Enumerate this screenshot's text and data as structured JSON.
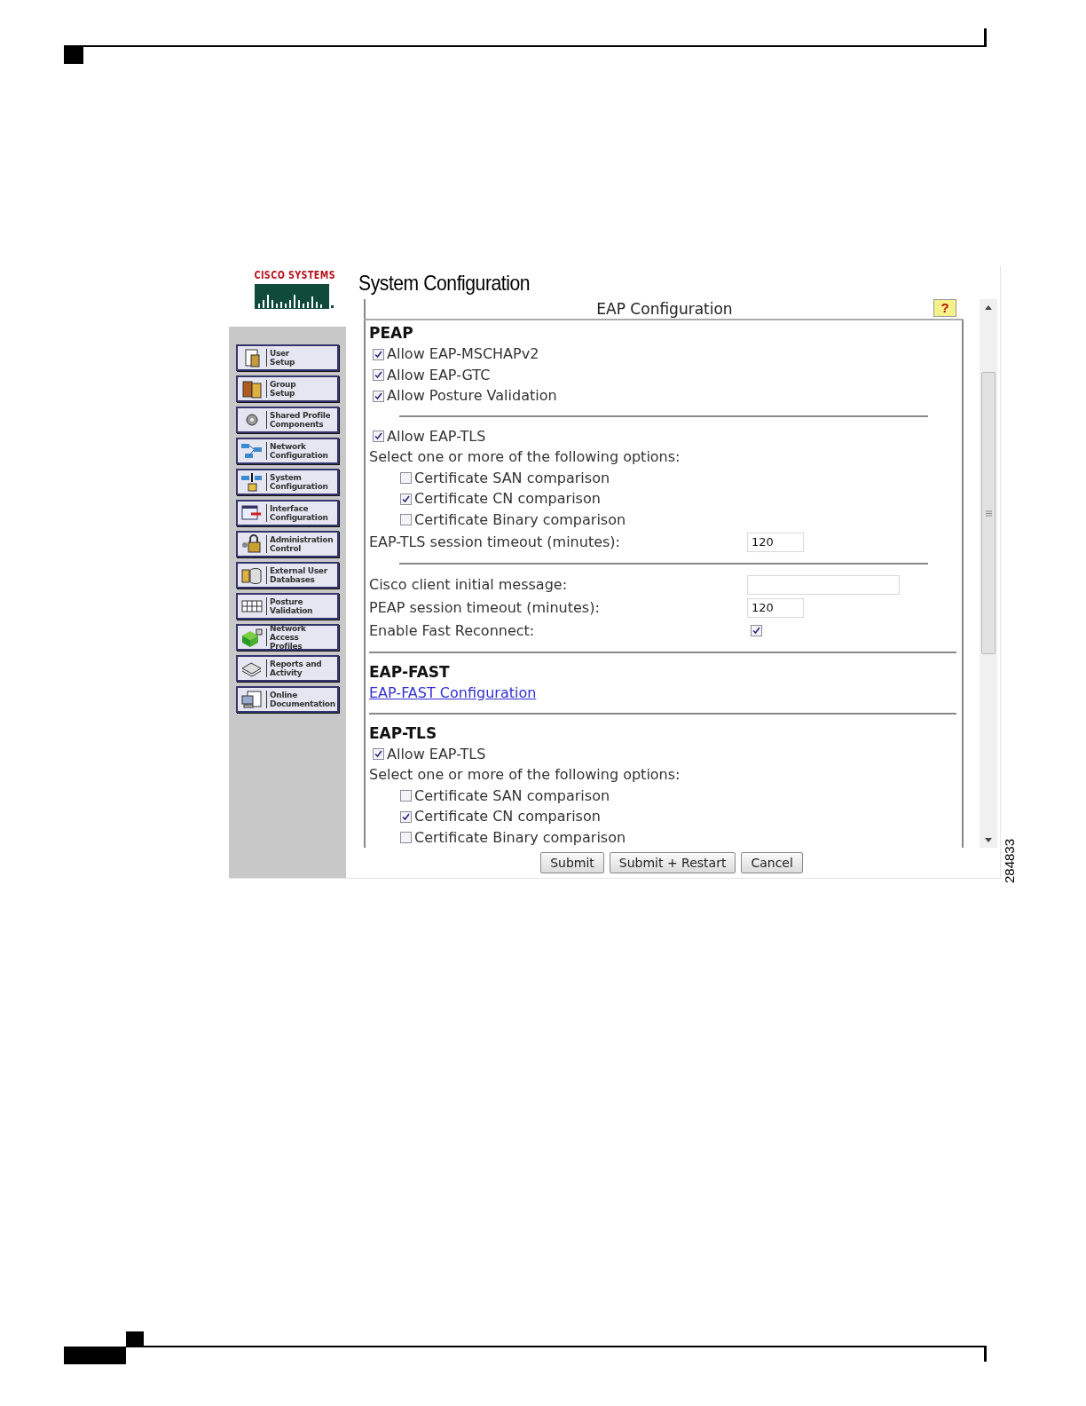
{
  "logo": {
    "text": "CISCO SYSTEMS"
  },
  "sidebar": {
    "items": [
      {
        "label": "User\nSetup"
      },
      {
        "label": "Group\nSetup"
      },
      {
        "label": "Shared Profile\nComponents"
      },
      {
        "label": "Network\nConfiguration"
      },
      {
        "label": "System\nConfiguration"
      },
      {
        "label": "Interface\nConfiguration"
      },
      {
        "label": "Administration\nControl"
      },
      {
        "label": "External User\nDatabases"
      },
      {
        "label": "Posture\nValidation"
      },
      {
        "label": "Network Access\nProfiles"
      },
      {
        "label": "Reports and\nActivity"
      },
      {
        "label": "Online\nDocumentation"
      }
    ]
  },
  "title": "System Configuration",
  "panel": {
    "title": "EAP Configuration",
    "help": "?",
    "rows": [
      {
        "kind": "heading",
        "text": "PEAP"
      },
      {
        "kind": "checkbox",
        "label": "Allow EAP-MSCHAPv2",
        "checked": true
      },
      {
        "kind": "checkbox",
        "label": "Allow EAP-GTC",
        "checked": true
      },
      {
        "kind": "checkbox",
        "label": "Allow Posture Validation",
        "checked": true
      },
      {
        "kind": "short_rule"
      },
      {
        "kind": "checkbox",
        "label": "Allow EAP-TLS",
        "checked": true
      },
      {
        "kind": "text",
        "text": "Select one or more of the following options:"
      },
      {
        "kind": "option",
        "label": "Certificate SAN comparison",
        "checked": false
      },
      {
        "kind": "option",
        "label": "Certificate CN comparison",
        "checked": true
      },
      {
        "kind": "option",
        "label": "Certificate Binary comparison",
        "checked": false
      },
      {
        "kind": "field",
        "label": "EAP-TLS session timeout (minutes):",
        "value": "120"
      },
      {
        "kind": "short_rule"
      },
      {
        "kind": "wide_field",
        "label": "Cisco client initial message:"
      },
      {
        "kind": "field",
        "label": "PEAP session timeout (minutes):",
        "value": "120"
      },
      {
        "kind": "check_field",
        "label": "Enable Fast Reconnect:",
        "checked": true
      },
      {
        "kind": "rule"
      },
      {
        "kind": "heading",
        "text": "EAP-FAST"
      },
      {
        "kind": "link",
        "text": "EAP-FAST Configuration"
      },
      {
        "kind": "rule"
      },
      {
        "kind": "heading",
        "text": "EAP-TLS"
      },
      {
        "kind": "checkbox",
        "label": "Allow EAP-TLS",
        "checked": true
      },
      {
        "kind": "text",
        "text": "Select one or more of the following options:"
      },
      {
        "kind": "option",
        "label": "Certificate SAN comparison",
        "checked": false
      },
      {
        "kind": "option",
        "label": "Certificate CN comparison",
        "checked": true
      },
      {
        "kind": "option",
        "label": "Certificate Binary comparison",
        "checked": false
      }
    ]
  },
  "buttons": [
    {
      "label": "Submit"
    },
    {
      "label": "Submit + Restart"
    },
    {
      "label": "Cancel"
    }
  ],
  "figure_number": "284833"
}
